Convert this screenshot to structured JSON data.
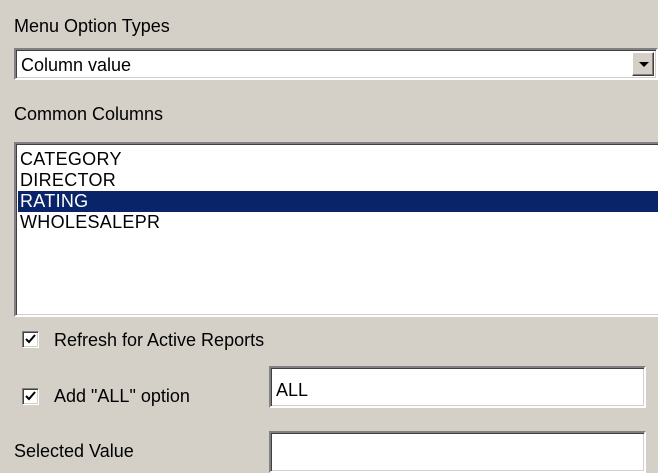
{
  "menu_option_types": {
    "label": "Menu Option Types",
    "selected_value": "Column value"
  },
  "common_columns": {
    "label": "Common Columns",
    "items": [
      "CATEGORY",
      "DIRECTOR",
      "RATING",
      "WHOLESALEPR"
    ],
    "selected_index": 2
  },
  "refresh_active_reports": {
    "label": "Refresh for Active Reports",
    "checked": true
  },
  "add_all_option": {
    "label": "Add \"ALL\" option",
    "checked": true,
    "value": "ALL"
  },
  "selected_value": {
    "label": "Selected Value",
    "value": ""
  },
  "colors": {
    "background": "#d4d0c8",
    "selection": "#0a246a"
  }
}
